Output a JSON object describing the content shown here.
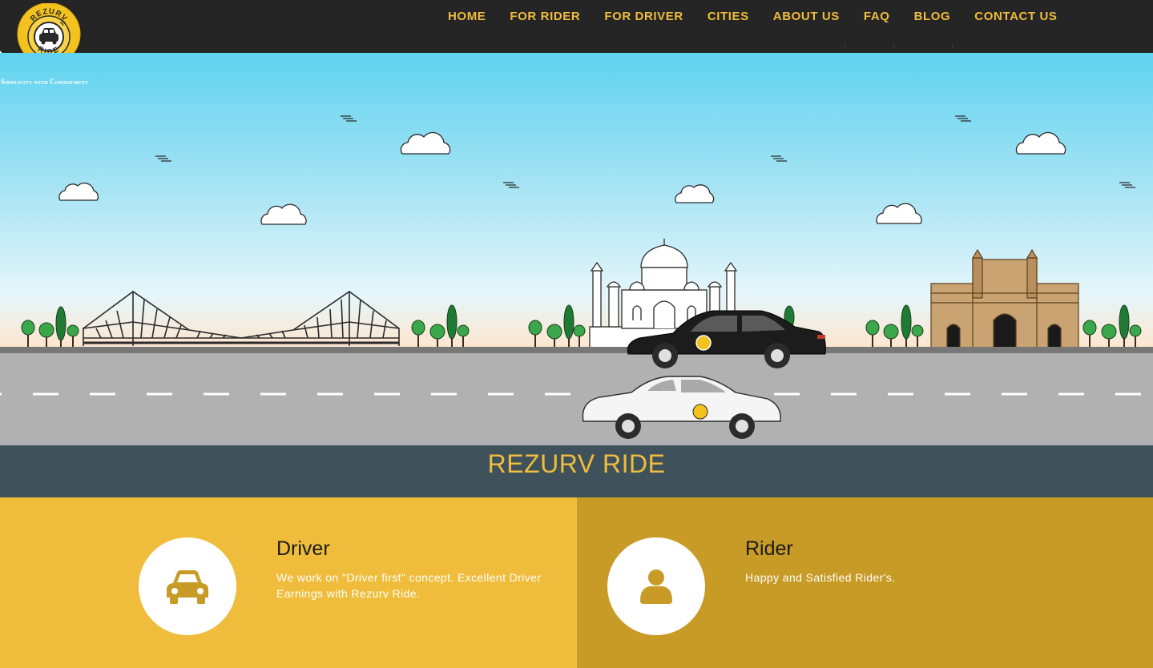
{
  "brand": {
    "logo_top_text": "REZURV",
    "logo_bottom_text": "RIDE",
    "tagline": "Simplicity with Commitment"
  },
  "nav": {
    "items": [
      "HOME",
      "FOR RIDER",
      "FOR DRIVER",
      "CITIES",
      "ABOUT US",
      "FAQ",
      "BLOG",
      "CONTACT US"
    ]
  },
  "hero": {
    "title": "REZURV RIDE"
  },
  "features": {
    "driver": {
      "title": "Driver",
      "description": "We work on \"Driver first\" concept. Excellent Driver Earnings with Rezurv Ride.",
      "icon": "car-icon"
    },
    "rider": {
      "title": "Rider",
      "description": "Happy and Satisfied Rider's.",
      "icon": "user-icon"
    }
  },
  "colors": {
    "accent": "#f0bd3c",
    "header_bg": "#252525",
    "band_bg": "#3f525c",
    "driver_panel": "#efbd3b",
    "rider_panel": "#c89b27"
  }
}
